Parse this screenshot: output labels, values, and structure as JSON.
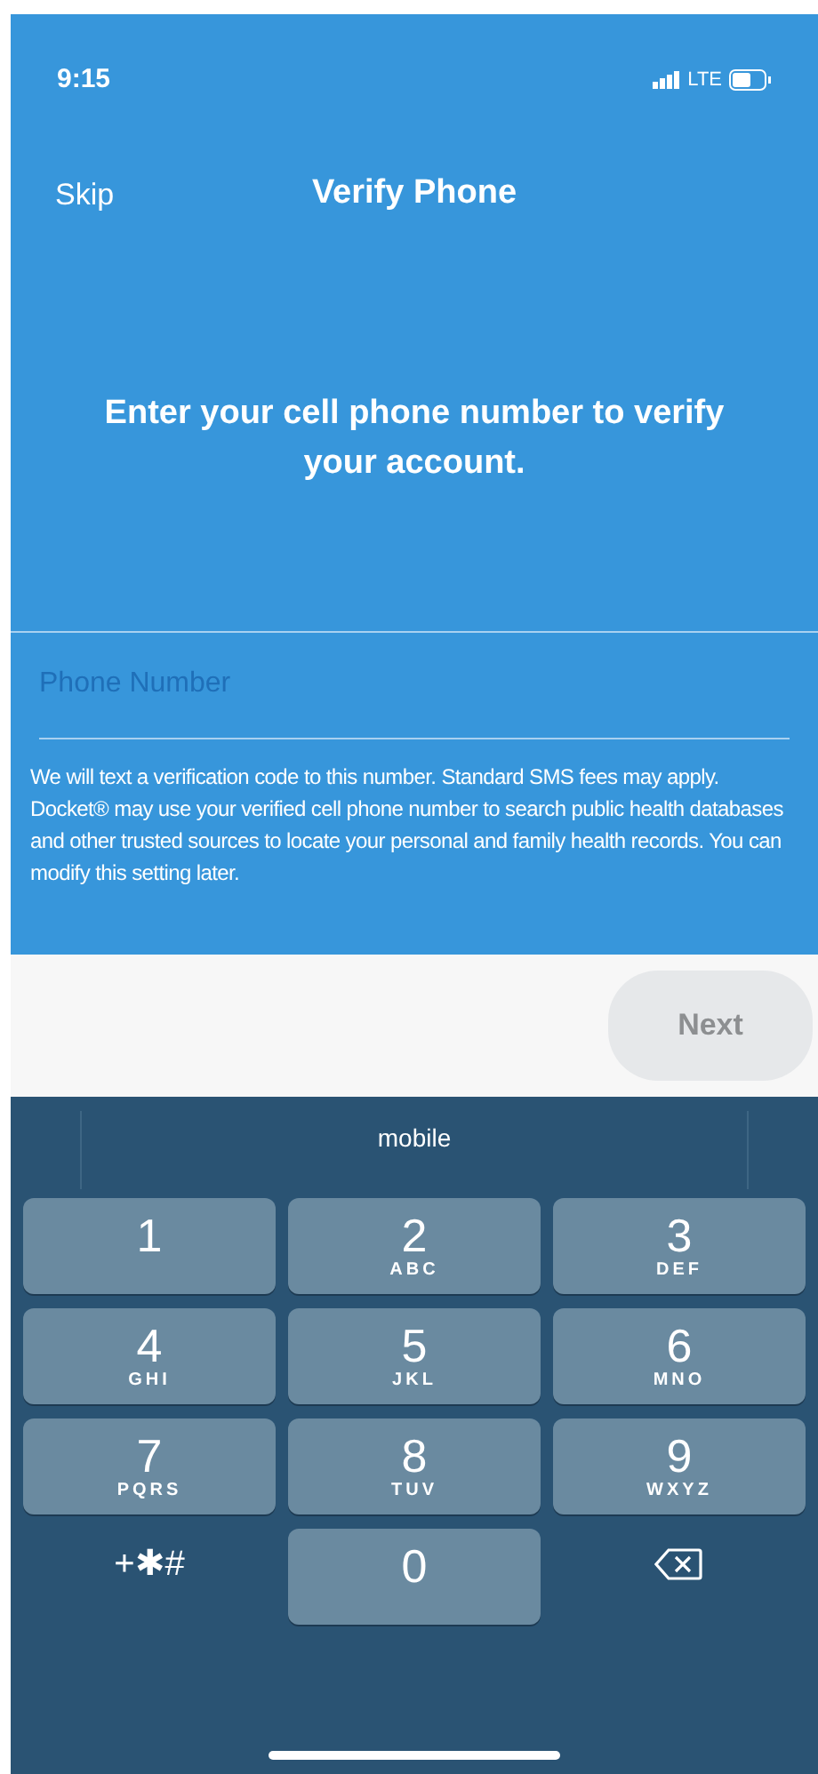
{
  "status_bar": {
    "time": "9:15",
    "network": "LTE"
  },
  "nav": {
    "left": "Skip",
    "title": "Verify Phone"
  },
  "headline": "Enter your cell phone number to verify your account.",
  "phone_field": {
    "placeholder": "Phone Number"
  },
  "disclaimer": "We will text a verification code to this number. Standard SMS fees may apply. Docket® may use your verified cell phone number to search public health databases and other trusted sources to locate your personal and family health records. You can modify this setting later.",
  "next_button": {
    "label": "Next",
    "disabled": true
  },
  "keyboard": {
    "suggestion": "mobile",
    "keys": [
      {
        "kind": "digit",
        "digit": "1"
      },
      {
        "kind": "digit",
        "digit": "2",
        "letters": "ABC"
      },
      {
        "kind": "digit",
        "digit": "3",
        "letters": "DEF"
      },
      {
        "kind": "digit",
        "digit": "4",
        "letters": "GHI"
      },
      {
        "kind": "digit",
        "digit": "5",
        "letters": "JKL"
      },
      {
        "kind": "digit",
        "digit": "6",
        "letters": "MNO"
      },
      {
        "kind": "digit",
        "digit": "7",
        "letters": "PQRS"
      },
      {
        "kind": "digit",
        "digit": "8",
        "letters": "TUV"
      },
      {
        "kind": "digit",
        "digit": "9",
        "letters": "WXYZ"
      },
      {
        "kind": "symbols",
        "label": "+✱#"
      },
      {
        "kind": "digit",
        "digit": "0"
      },
      {
        "kind": "delete"
      }
    ]
  }
}
